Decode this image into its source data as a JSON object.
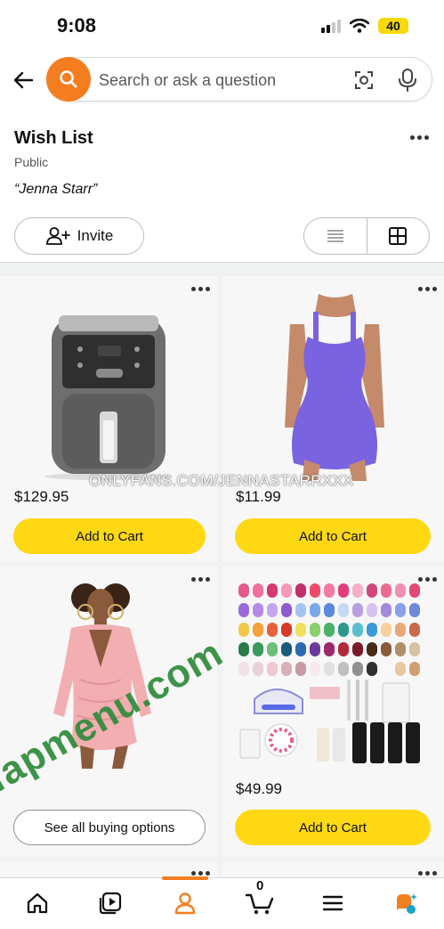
{
  "status": {
    "time": "9:08",
    "battery": "40"
  },
  "search": {
    "placeholder": "Search or ask a question"
  },
  "wishlist": {
    "title": "Wish List",
    "privacy": "Public",
    "owner": "“Jenna Starr”",
    "invite_label": "Invite"
  },
  "items": [
    {
      "name": "Air fryer",
      "price": "$129.95",
      "action": "Add to Cart"
    },
    {
      "name": "Purple bodycon dress",
      "price": "$11.99",
      "action": "Add to Cart"
    },
    {
      "name": "Pink ruched dress",
      "price": "",
      "action": "See all buying options"
    },
    {
      "name": "Gel nail polish kit",
      "price": "$49.99",
      "action": "Add to Cart"
    }
  ],
  "watermark": "ONLYFANS.COM/JENNASTARRXXX",
  "brand_mark": "fapmenu.com",
  "nav": {
    "cart_count": "0"
  },
  "colors": {
    "accent": "#f47d20",
    "cart_button": "#ffd814",
    "brand_mark": "#2e8b3a"
  }
}
